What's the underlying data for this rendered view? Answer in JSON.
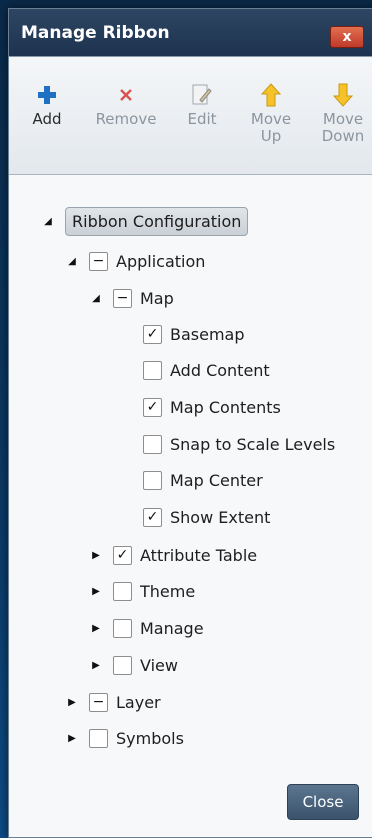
{
  "window": {
    "title": "Manage Ribbon",
    "close_glyph": "x"
  },
  "toolbar": {
    "add": {
      "line1": "Add",
      "line2": "",
      "icon": "plus-icon",
      "color": "#1f6fc2"
    },
    "remove": {
      "line1": "Remove",
      "line2": "",
      "icon": "x-icon",
      "color": "#d9534f"
    },
    "edit": {
      "line1": "Edit",
      "line2": "",
      "icon": "edit-icon"
    },
    "move_up": {
      "line1": "Move",
      "line2": "Up",
      "icon": "arrow-up-icon",
      "color": "#f5c22a"
    },
    "move_down": {
      "line1": "Move",
      "line2": "Down",
      "icon": "arrow-down-icon",
      "color": "#f5c22a"
    }
  },
  "tree": {
    "root": {
      "label": "Ribbon Configuration",
      "expanded": true
    },
    "application": {
      "label": "Application",
      "state": "partial",
      "expanded": true
    },
    "map": {
      "label": "Map",
      "state": "partial",
      "expanded": true
    },
    "basemap": {
      "label": "Basemap",
      "checked": true
    },
    "add_content": {
      "label": "Add Content",
      "checked": false
    },
    "map_contents": {
      "label": "Map Contents",
      "checked": true
    },
    "snap_to_scale": {
      "label": "Snap to Scale Levels",
      "checked": false
    },
    "map_center": {
      "label": "Map Center",
      "checked": false
    },
    "show_extent": {
      "label": "Show Extent",
      "checked": true
    },
    "attribute_table": {
      "label": "Attribute Table",
      "checked": true,
      "expanded": false
    },
    "theme": {
      "label": "Theme",
      "checked": false,
      "expanded": false
    },
    "manage": {
      "label": "Manage",
      "checked": false,
      "expanded": false
    },
    "view": {
      "label": "View",
      "checked": false,
      "expanded": false
    },
    "layer": {
      "label": "Layer",
      "state": "partial",
      "expanded": false
    },
    "symbols": {
      "label": "Symbols",
      "checked": false,
      "expanded": false
    }
  },
  "footer": {
    "close_label": "Close"
  },
  "glyphs": {
    "check": "✓",
    "partial": "−",
    "expanded": "◢",
    "collapsed": "▶"
  }
}
